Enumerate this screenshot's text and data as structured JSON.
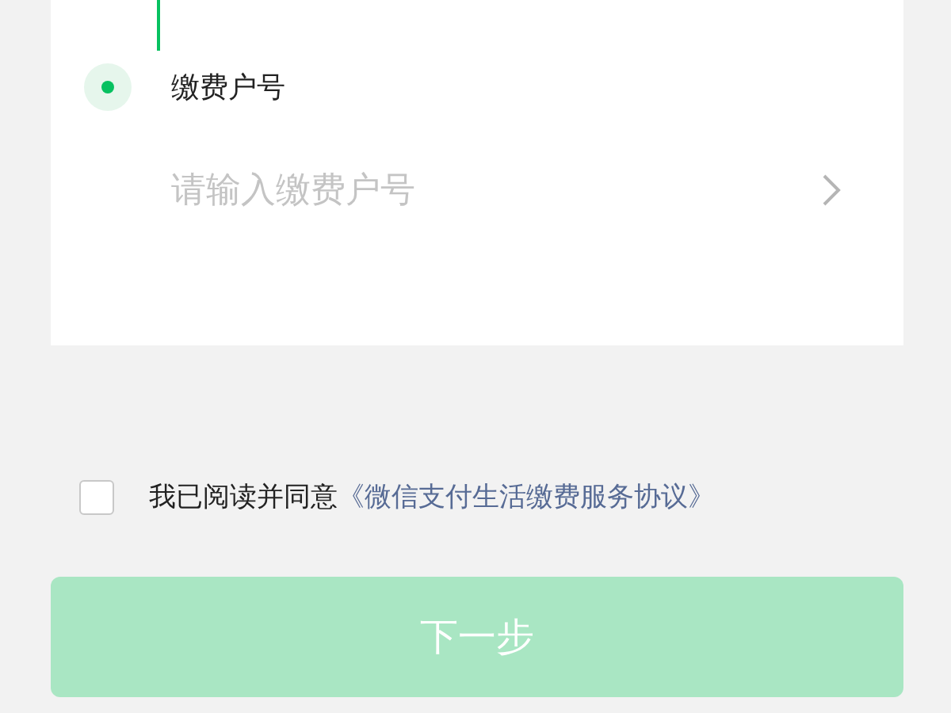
{
  "form": {
    "step": {
      "label": "缴费户号",
      "active": true
    },
    "field": {
      "placeholder": "请输入缴费户号"
    }
  },
  "agreement": {
    "checked": false,
    "text": "我已阅读并同意",
    "link": "《微信支付生活缴费服务协议》"
  },
  "next_button": {
    "label": "下一步",
    "disabled": true
  }
}
